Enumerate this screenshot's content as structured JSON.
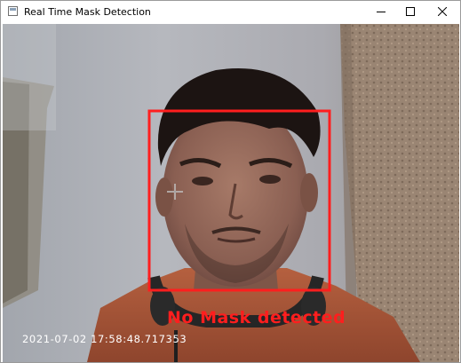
{
  "window": {
    "title": "Real Time Mask Detection"
  },
  "detection": {
    "label": "No Mask detected",
    "box_color": "#ff1e1e"
  },
  "overlay": {
    "timestamp": "2021-07-02 17:58:48.717353"
  },
  "icons": {
    "app": "opencv-window-icon",
    "minimize": "minimize-icon",
    "maximize": "maximize-icon",
    "close": "close-icon",
    "cursor": "crosshair-cursor-icon"
  }
}
